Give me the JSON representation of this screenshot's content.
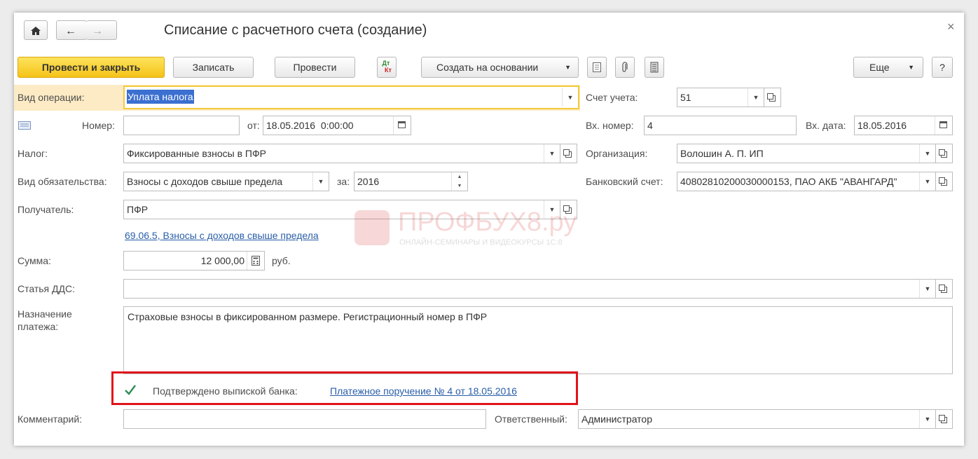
{
  "window": {
    "title": "Списание с расчетного счета (создание)",
    "close_glyph": "×"
  },
  "toolbar": {
    "post_close_label": "Провести и закрыть",
    "save_label": "Записать",
    "post_label": "Провести",
    "dtkt_label_top": "Дт",
    "dtkt_label_bottom": "Кт",
    "create_based_label": "Создать на основании",
    "more_label": "Еще",
    "help_label": "?"
  },
  "form": {
    "operation_type_label": "Вид операции:",
    "operation_type_value": "Уплата налога",
    "account_label": "Счет учета:",
    "account_value": "51",
    "number_label": "Номер:",
    "number_value": "",
    "date_from_label": "от:",
    "date_value": "18.05.2016  0:00:00",
    "in_number_label": "Вх. номер:",
    "in_number_value": "4",
    "in_date_label": "Вх. дата:",
    "in_date_value": "18.05.2016",
    "tax_label": "Налог:",
    "tax_value": "Фиксированные взносы в ПФР",
    "organization_label": "Организация:",
    "organization_value": "Волошин А. П. ИП",
    "obligation_label": "Вид обязательства:",
    "obligation_value": "Взносы с доходов свыше предела",
    "period_label": "за:",
    "period_value": "2016",
    "bank_account_label": "Банковский счет:",
    "bank_account_value": "40802810200030000153, ПАО АКБ \"АВАНГАРД\"",
    "recipient_label": "Получатель:",
    "recipient_value": "ПФР",
    "account_link": "69.06.5, Взносы с доходов свыше предела",
    "amount_label": "Сумма:",
    "amount_value": "12 000,00",
    "currency_label": "руб.",
    "cashflow_label": "Статья ДДС:",
    "cashflow_value": "",
    "purpose_label_1": "Назначение",
    "purpose_label_2": "платежа:",
    "purpose_value": "Страховые взносы в фиксированном размере. Регистрационный номер в ПФР",
    "confirmed_label": "Подтверждено выпиской банка:",
    "confirmed_checked": true,
    "payment_order_link": "Платежное поручение № 4 от 18.05.2016",
    "comment_label": "Комментарий:",
    "comment_value": "",
    "responsible_label": "Ответственный:",
    "responsible_value": "Администратор"
  },
  "watermark": {
    "brand": "ПРОФБУХ8.ру",
    "tagline": "ОНЛАЙН-СЕМИНАРЫ И ВИДЕОКУРСЫ 1С:8"
  },
  "colors": {
    "primary_button": "#f5c318",
    "highlight_box": "#e0141b",
    "link": "#2a5ea8",
    "selection": "#3b6fd0"
  }
}
